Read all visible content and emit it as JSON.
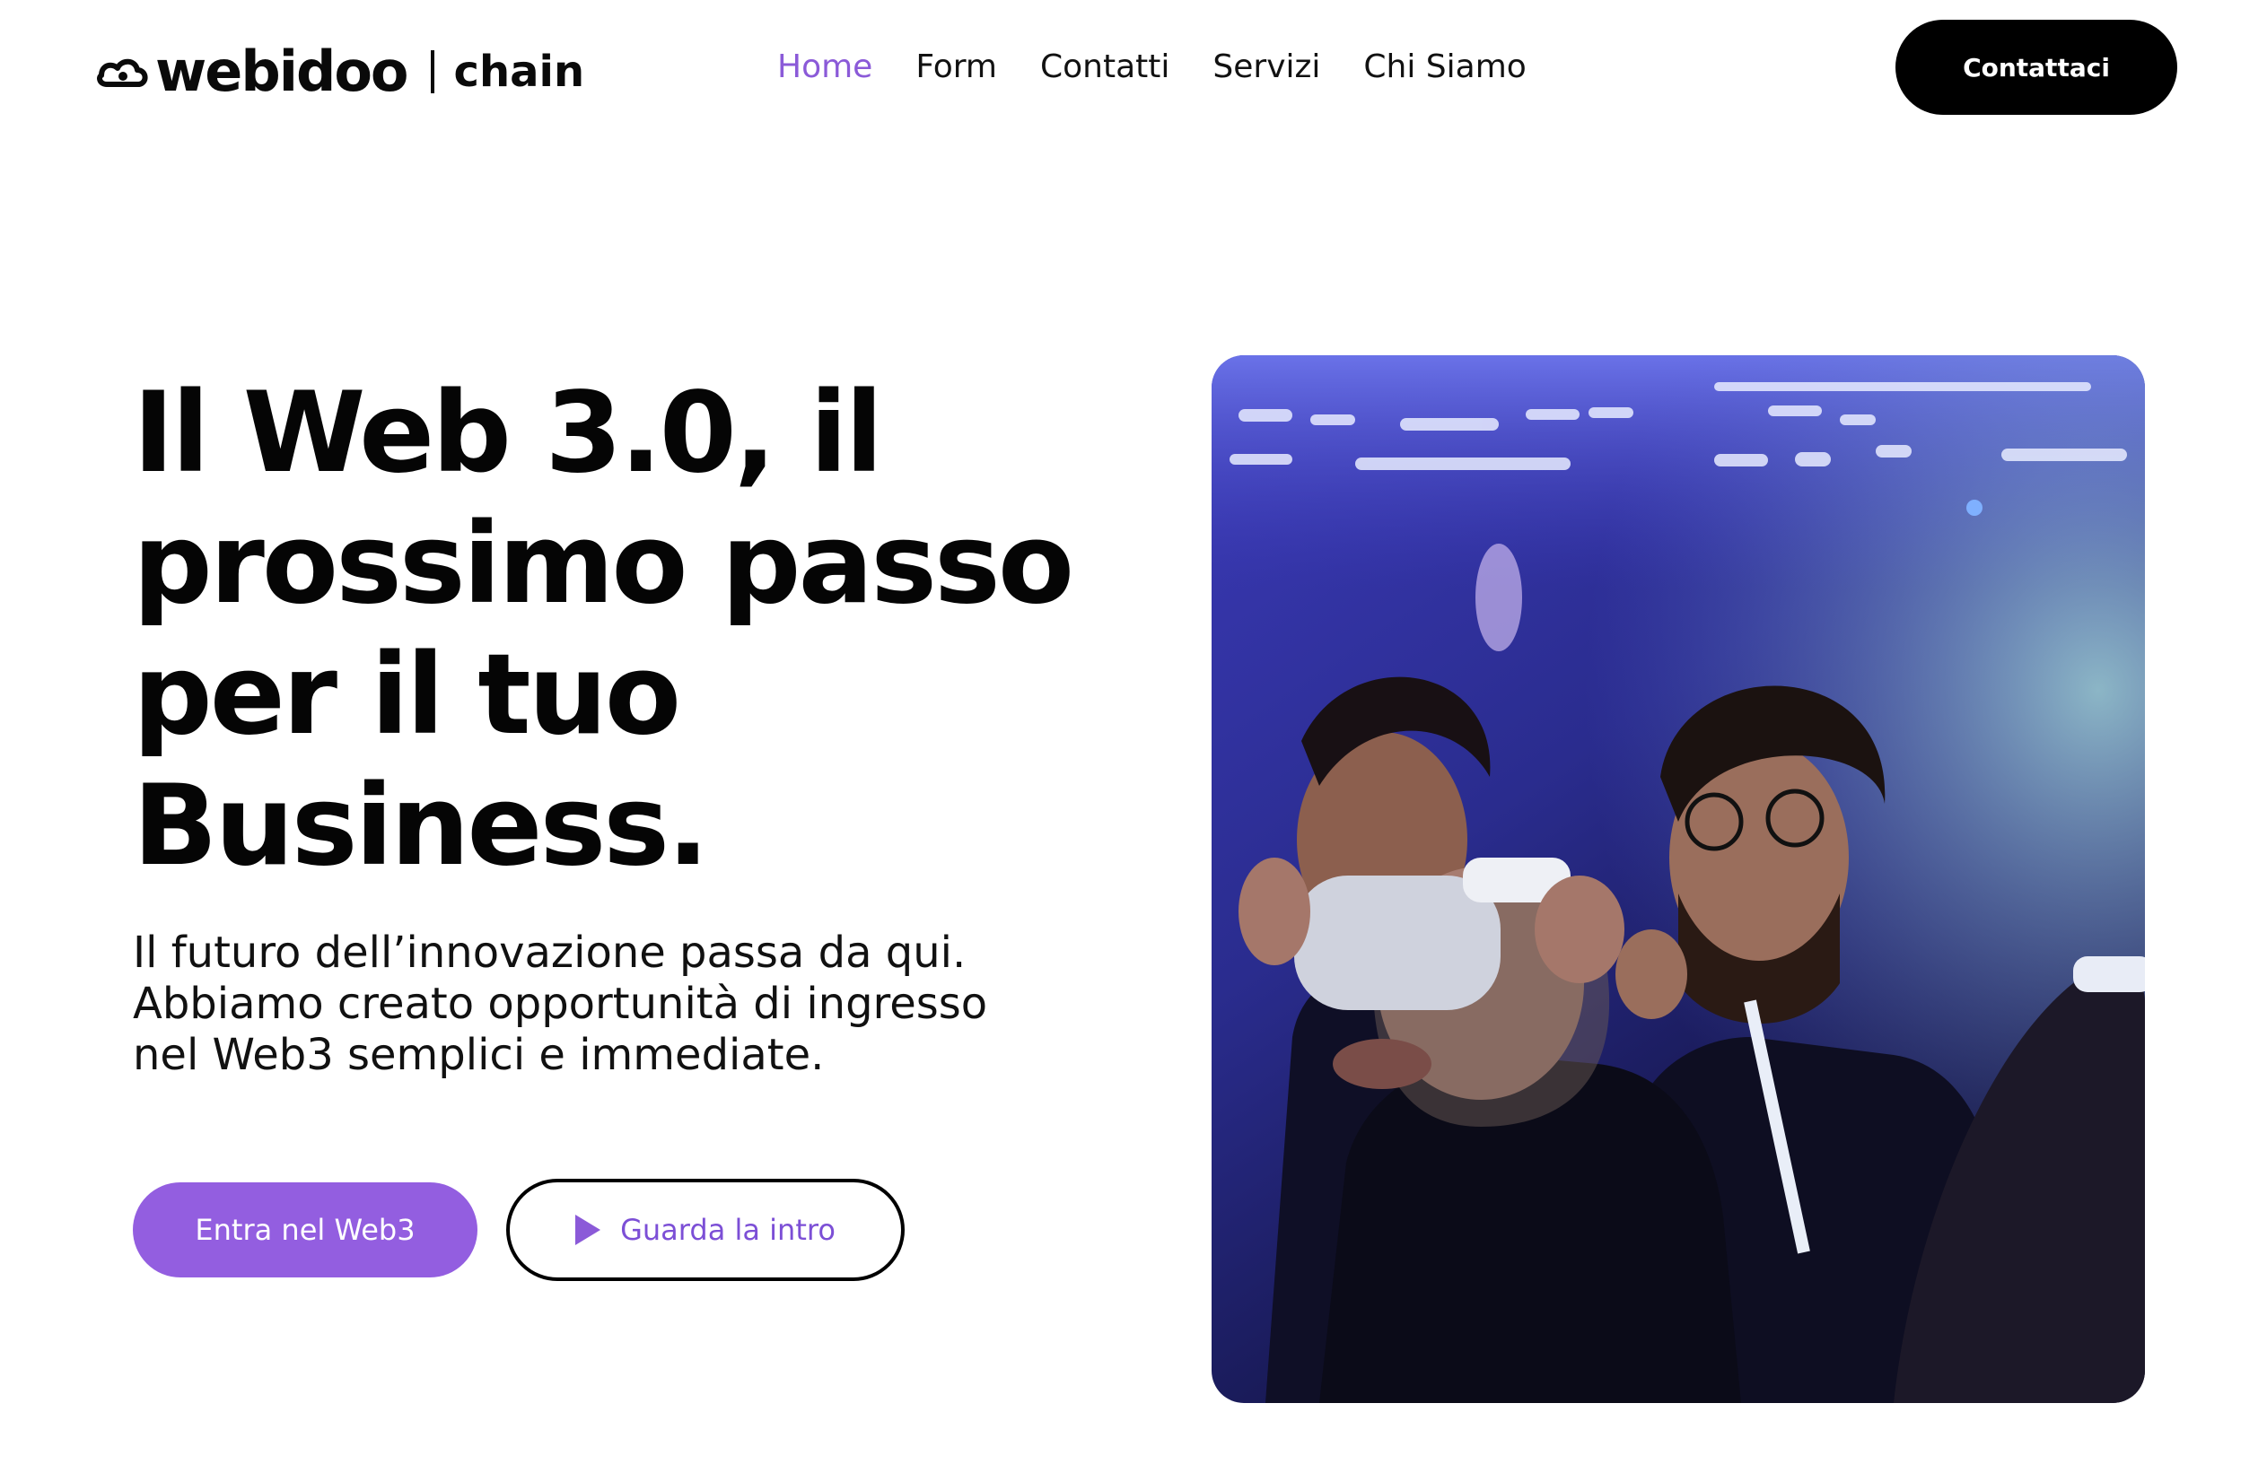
{
  "brand": {
    "name": "webidoo",
    "suffix": "chain"
  },
  "nav": {
    "items": [
      {
        "label": "Home",
        "active": true
      },
      {
        "label": "Form",
        "active": false
      },
      {
        "label": "Contatti",
        "active": false
      },
      {
        "label": "Servizi",
        "active": false
      },
      {
        "label": "Chi Siamo",
        "active": false
      }
    ]
  },
  "header": {
    "cta_label": "Contattaci"
  },
  "hero": {
    "title": "Il Web 3.0, il prossimo passo per il tuo Business.",
    "subtitle_lines": [
      "Il futuro dell’innovazione passa da qui.",
      "Abbiamo creato opportunità di ingresso",
      "nel Web3 semplici e immediate."
    ],
    "primary_button": "Entra nel Web3",
    "secondary_button": "Guarda la intro",
    "secondary_icon": "play-icon",
    "image_icon": "vr-headset-photo"
  },
  "colors": {
    "accent": "#935ee0",
    "accent_text": "#8b5ad8",
    "text": "#0a0a0a",
    "background": "#ffffff",
    "cta_dark": "#000000"
  }
}
